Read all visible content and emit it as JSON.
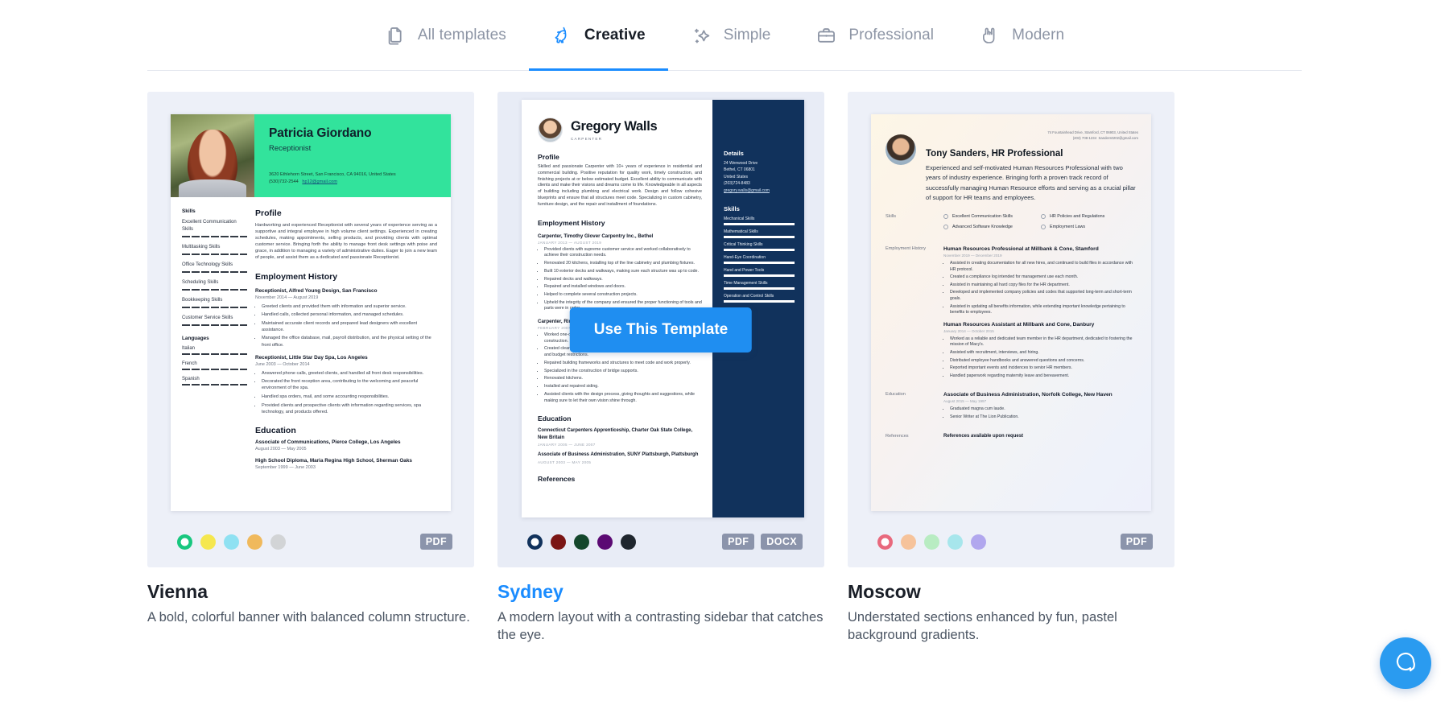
{
  "tabs": [
    {
      "label": "All templates",
      "icon": "documents-icon",
      "active": false
    },
    {
      "label": "Creative",
      "icon": "unicorn-icon",
      "active": true
    },
    {
      "label": "Simple",
      "icon": "sparkles-icon",
      "active": false
    },
    {
      "label": "Professional",
      "icon": "briefcase-icon",
      "active": false
    },
    {
      "label": "Modern",
      "icon": "rock-hand-icon",
      "active": false
    }
  ],
  "hover_button": {
    "label": "Use This Template"
  },
  "colors": {
    "accent_blue": "#1a8cff",
    "button_blue": "#1f8ef1",
    "badge_gray": "#8b94ab",
    "preview_bg": "#edf0f8",
    "vienna_banner": "#32e39c",
    "sydney_sidebar": "#11325c"
  },
  "cards": [
    {
      "name": "Vienna",
      "description": "A bold, colorful banner with balanced column structure.",
      "highlighted": false,
      "formats": [
        "PDF"
      ],
      "swatches": [
        {
          "color": "#18c77f",
          "selected": true
        },
        {
          "color": "#f5e74f",
          "selected": false
        },
        {
          "color": "#8fe1f2",
          "selected": false
        },
        {
          "color": "#f0b95c",
          "selected": false
        },
        {
          "color": "#d2d4d6",
          "selected": false
        }
      ],
      "resume": {
        "name": "Patricia Giordano",
        "role": "Receptionist",
        "address": "3620 Ethlehorn Street, San Francisco, CA 94016, United States",
        "phone": "(530)732-2544",
        "email": "hp12@gmail.com",
        "skills_heading": "Skills",
        "skills": [
          "Excellent Communication Skills",
          "Multitasking Skills",
          "Office Technology Skills",
          "Scheduling Skills",
          "Bookkeeping Skills",
          "Customer Service Skills"
        ],
        "languages_heading": "Languages",
        "languages": [
          "Italian",
          "French",
          "Spanish"
        ],
        "profile_heading": "Profile",
        "profile": "Hardworking and experienced Receptionist with several years of experience serving as a supportive and integral employee in high volume client settings. Experienced in creating schedules, making appointments, selling products, and providing clients with optimal customer service. Bringing forth the ability to manage front desk settings with poise and grace, in addition to managing a variety of administrative duties. Eager to join a new team of people, and assist them as a dedicated and passionate Receptionist.",
        "employment_heading": "Employment History",
        "jobs": [
          {
            "title": "Receptionist, Alfred Young Design, San Francisco",
            "date": "November 2014 — August 2019",
            "bullets": [
              "Greeted clients and provided them with information and superior service.",
              "Handled calls, collected personal information, and managed schedules.",
              "Maintained accurate client records and prepared lead designers with excellent assistance.",
              "Managed the office database, mail, payroll distribution, and the physical setting of the front office."
            ]
          },
          {
            "title": "Receptionist, Little Star Day Spa, Los Angeles",
            "date": "June 2003 — October 2014",
            "bullets": [
              "Answered phone calls, greeted clients, and handled all front desk responsibilities.",
              "Decorated the front reception area, contributing to the welcoming and peaceful environment of the spa.",
              "Handled spa orders, mail, and some accounting responsibilities.",
              "Provided clients and prospective clients with information regarding services, spa technology, and products offered."
            ]
          }
        ],
        "education_heading": "Education",
        "education": [
          {
            "title": "Associate of Communications, Pierce College, Los Angeles",
            "date": "August 2003 — May 2005"
          },
          {
            "title": "High School Diploma, Maria Regina High School, Sherman Oaks",
            "date": "September 1999 — June 2003"
          }
        ]
      }
    },
    {
      "name": "Sydney",
      "description": "A modern layout with a contrasting sidebar that catches the eye.",
      "highlighted": true,
      "formats": [
        "PDF",
        "DOCX"
      ],
      "swatches": [
        {
          "color": "#11325c",
          "selected": true
        },
        {
          "color": "#7b1515",
          "selected": false
        },
        {
          "color": "#14472c",
          "selected": false
        },
        {
          "color": "#5b0a73",
          "selected": false
        },
        {
          "color": "#1f262e",
          "selected": false
        }
      ],
      "resume": {
        "name": "Gregory Walls",
        "role": "CARPENTER",
        "profile_heading": "Profile",
        "profile": "Skilled and passionate Carpenter with 10+ years of experience in residential and commercial building. Positive reputation for quality work, timely construction, and finishing projects at or below estimated budget. Excellent ability to communicate with clients and make their visions and dreams come to life. Knowledgeable in all aspects of building including plumbing and electrical work. Design and follow cohesive blueprints and ensure that all structures meet code. Specializing in custom cabinetry, furniture design, and the repair and installment of foundations.",
        "employment_heading": "Employment History",
        "jobs": [
          {
            "title": "Carpenter, Timothy Glover Carpentry Inc., Bethel",
            "date": "JANUARY 2013 — AUGUST 2019",
            "bullets": [
              "Provided clients with supreme customer service and worked collaboratively to achieve their construction needs.",
              "Renovated 20 kitchens, installing top of the line cabinetry and plumbing fixtures.",
              "Built 10 exterior decks and walkways, making sure each structure was up to code.",
              "Repaired decks and walkways.",
              "Repaired and installed windows and doors.",
              "Helped to complete several construction projects.",
              "Upheld the integrity of the company and ensured the proper functioning of tools and parts were in order."
            ]
          },
          {
            "title": "Carpenter, Ringwood Inc., Brookfield",
            "date": "FEBRUARY 2007 — DECEMBER 2012",
            "bullets": [
              "Worked one-on-one with clients to assess their needs and desires before beginning construction.",
              "Created clear blueprints and financial budgets, keeping in mind the client's needs and budget restrictions.",
              "Repaired building frameworks and structures to meet code and work properly.",
              "Specialized in the construction of bridge supports.",
              "Renovated kitchens.",
              "Installed and repaired siding.",
              "Assisted clients with the design process, giving thoughts and suggestions, while making sure to let their own vision shine through."
            ]
          }
        ],
        "education_heading": "Education",
        "education": [
          {
            "title": "Connecticut Carpenters Apprenticeship, Charter Oak State College, New Britain",
            "date": "JANUARY 2005 — JUNE 2007"
          },
          {
            "title": "Associate of Business Administration, SUNY Plattsburgh, Plattsburgh",
            "date": "AUGUST 2003 — MAY 2005"
          }
        ],
        "references_heading": "References",
        "details_heading": "Details",
        "details": [
          "24 Wenwood Drive",
          "Bethel, CT 06801",
          "United States",
          "(203)724-8483",
          "gregory.walls@gmail.com"
        ],
        "skills_heading": "Skills",
        "skills": [
          "Mechanical Skills",
          "Mathematical Skills",
          "Critical Thinking Skills",
          "Hand-Eye Coordination",
          "Hand and Power Tools",
          "Time Management Skills",
          "Operation and Control Skills"
        ]
      }
    },
    {
      "name": "Moscow",
      "description": "Understated sections enhanced by fun, pastel background gradients.",
      "highlighted": false,
      "formats": [
        "PDF"
      ],
      "swatches": [
        {
          "color": "#e8697d",
          "selected": true
        },
        {
          "color": "#f6c39b",
          "selected": false
        },
        {
          "color": "#b8ecc2",
          "selected": false
        },
        {
          "color": "#a7e6ec",
          "selected": false
        },
        {
          "color": "#b1a7ee",
          "selected": false
        }
      ],
      "resume": {
        "address": "74 Fountainhead Drive, Stamford, CT 06903, United States",
        "phone": "(203) 708-1234",
        "email": "Sanders0202@gmail.com",
        "name": "Tony Sanders, HR Professional",
        "profile": "Experienced and self-motivated Human Resources Professional with two years of industry experience. Bringing forth a proven track record of successfully managing Human Resource efforts and serving as a crucial pillar of support for HR teams and employees.",
        "skills_label": "Skills",
        "skills": [
          "Excellent Communication Skills",
          "HR Policies and Regulations",
          "Advanced Software Knowledge",
          "Employment Laws"
        ],
        "employment_label": "Employment History",
        "jobs": [
          {
            "title": "Human Resources Professional at Millbank & Cone, Stamford",
            "date": "November 2019 — December 2019",
            "bullets": [
              "Assisted in creating documentation for all new hires, and continued to build files in accordance with HR protocol.",
              "Created a compliance log intended for management use each month.",
              "Assisted in maintaining all hard copy files for the HR department.",
              "Developed and implemented company policies and codes that supported long-term and short-term goals.",
              "Assisted in updating all benefits information, while extending important knowledge pertaining to benefits to employees."
            ]
          },
          {
            "title": "Human Resources Assistant at Millbank and Cone, Danbury",
            "date": "January 2014 — October 2015",
            "bullets": [
              "Worked as a reliable and dedicated team member in the HR department, dedicated to fostering the mission of Macy's.",
              "Assisted with recruitment, interviews, and hiring.",
              "Distributed employee handbooks and answered questions and concerns.",
              "Reported important events and incidences to senior HR members.",
              "Handled paperwork regarding maternity leave and bereavement."
            ]
          }
        ],
        "education_label": "Education",
        "education_title": "Associate of Business Administration, Norfolk College, New Haven",
        "education_date": "August 2015 — May 1997",
        "education_bullets": [
          "Graduated magna cum laude.",
          "Senior Writer at The Lion Publication."
        ],
        "references_label": "References",
        "references": "References available upon request"
      }
    }
  ],
  "chat": {
    "icon": "chat-bubble-icon"
  }
}
